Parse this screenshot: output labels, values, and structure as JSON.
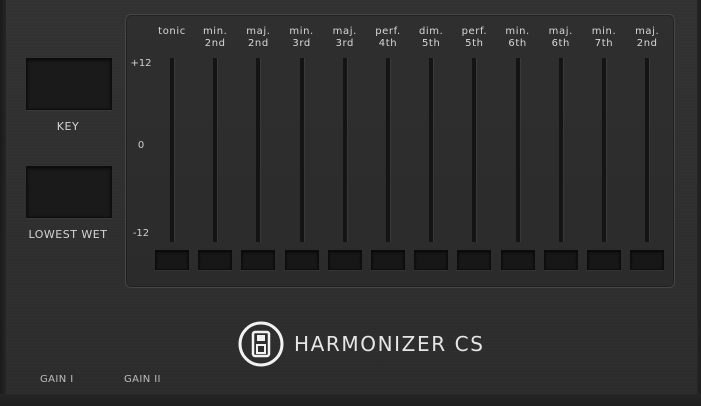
{
  "plugin": {
    "title": "HARMONIZER CS",
    "logo_icon": "disk-icon"
  },
  "left_panel": {
    "key_label": "KEY",
    "lowest_wet_label": "LOWEST WET"
  },
  "scale": {
    "top": "+12",
    "middle": "0",
    "bottom": "-12"
  },
  "intervals": [
    {
      "label": "tonic"
    },
    {
      "label": "min.\n2nd"
    },
    {
      "label": "maj.\n2nd"
    },
    {
      "label": "min.\n3rd"
    },
    {
      "label": "maj.\n3rd"
    },
    {
      "label": "perf.\n4th"
    },
    {
      "label": "dim.\n5th"
    },
    {
      "label": "perf.\n5th"
    },
    {
      "label": "min.\n6th"
    },
    {
      "label": "maj.\n6th"
    },
    {
      "label": "min.\n7th"
    },
    {
      "label": "maj.\n2nd"
    }
  ],
  "footer": {
    "gain_1": "GAIN I",
    "gain_2": "GAIN II"
  },
  "colors": {
    "background": "#2e2e2e",
    "panel_border": "#464646",
    "track": "#141414",
    "text": "#d4d4d4"
  }
}
